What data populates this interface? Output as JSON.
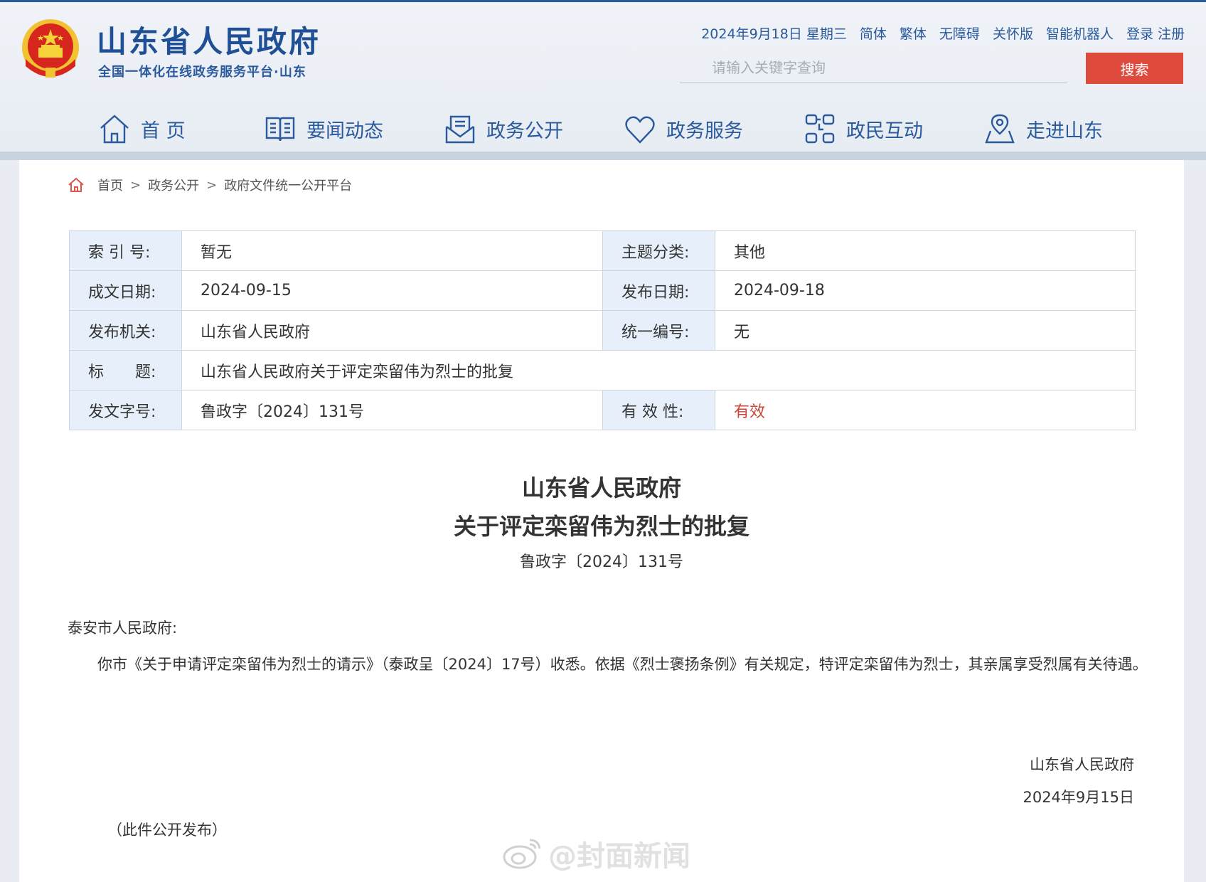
{
  "header": {
    "site_title": "山东省人民政府",
    "site_subtitle": "全国一体化在线政务服务平台·山东",
    "date": "2024年9月18日 星期三",
    "links": [
      "简体",
      "繁体",
      "无障碍",
      "关怀版",
      "智能机器人",
      "登录",
      "注册"
    ],
    "search_placeholder": "请输入关键字查询",
    "search_button": "搜索"
  },
  "nav": [
    {
      "label": "首 页",
      "icon": "home-icon"
    },
    {
      "label": "要闻动态",
      "icon": "book-icon"
    },
    {
      "label": "政务公开",
      "icon": "mail-icon"
    },
    {
      "label": "政务服务",
      "icon": "heart-icon"
    },
    {
      "label": "政民互动",
      "icon": "interact-icon"
    },
    {
      "label": "走进山东",
      "icon": "location-icon"
    }
  ],
  "breadcrumb": [
    "首页",
    "政务公开",
    "政府文件统一公开平台"
  ],
  "meta": {
    "index_label": "索 引 号:",
    "index_value": "暂无",
    "topic_label": "主题分类:",
    "topic_value": "其他",
    "written_label": "成文日期:",
    "written_value": "2024-09-15",
    "publish_label": "发布日期:",
    "publish_value": "2024-09-18",
    "issuer_label": "发布机关:",
    "issuer_value": "山东省人民政府",
    "serial_label": "统一编号:",
    "serial_value": "无",
    "title_label": "标　　题:",
    "title_value": "山东省人民政府关于评定栾留伟为烈士的批复",
    "docno_label": "发文字号:",
    "docno_value": "鲁政字〔2024〕131号",
    "validity_label": "有 效 性:",
    "validity_value": "有效",
    "validity_color": "#c8453a"
  },
  "document": {
    "title_line1": "山东省人民政府",
    "title_line2": "关于评定栾留伟为烈士的批复",
    "number": "鲁政字〔2024〕131号",
    "addressee": "泰安市人民政府:",
    "body": "你市《关于申请评定栾留伟为烈士的请示》（泰政呈〔2024〕17号）收悉。依据《烈士褒扬条例》有关规定，特评定栾留伟为烈士，其亲属享受烈属有关待遇。",
    "signature_org": "山东省人民政府",
    "signature_date": "2024年9月15日",
    "public_note": "（此件公开发布）"
  },
  "watermark": "@封面新闻",
  "colors": {
    "brand_blue": "#1f4f94",
    "search_red": "#de4a3c",
    "key_cell_bg": "#e7f0fa"
  }
}
